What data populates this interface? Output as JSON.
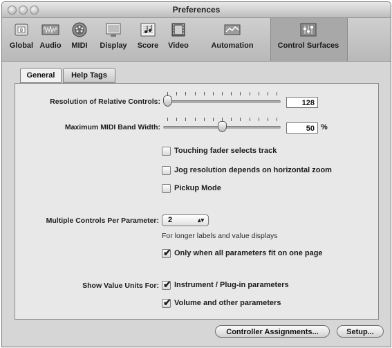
{
  "window": {
    "title": "Preferences"
  },
  "toolbar": {
    "items": [
      {
        "label": "Global",
        "icon": "global-icon"
      },
      {
        "label": "Audio",
        "icon": "audio-icon"
      },
      {
        "label": "MIDI",
        "icon": "midi-icon"
      },
      {
        "label": "Display",
        "icon": "display-icon"
      },
      {
        "label": "Score",
        "icon": "score-icon"
      },
      {
        "label": "Video",
        "icon": "video-icon"
      },
      {
        "label": "Automation",
        "icon": "automation-icon"
      },
      {
        "label": "Control Surfaces",
        "icon": "control-surfaces-icon"
      }
    ],
    "selected": "Control Surfaces"
  },
  "tabs": [
    {
      "label": "General",
      "active": true
    },
    {
      "label": "Help Tags",
      "active": false
    }
  ],
  "settings": {
    "resolution": {
      "label": "Resolution of Relative Controls:",
      "value": "128",
      "level": 0.0
    },
    "bandwidth": {
      "label": "Maximum MIDI Band Width:",
      "value": "50",
      "unit": "%",
      "level": 0.5
    },
    "options": [
      {
        "label": "Touching fader selects track",
        "checked": false
      },
      {
        "label": "Jog resolution depends on horizontal zoom",
        "checked": false
      },
      {
        "label": "Pickup Mode",
        "checked": false
      }
    ],
    "multiple": {
      "label": "Multiple Controls Per Parameter:",
      "value": "2",
      "hint": "For longer labels and value displays",
      "checkbox": {
        "label": "Only when all parameters fit on one page",
        "checked": true
      }
    },
    "units": {
      "label": "Show Value Units For:",
      "options": [
        {
          "label": "Instrument / Plug-in parameters",
          "checked": true
        },
        {
          "label": "Volume and other parameters",
          "checked": true
        }
      ]
    }
  },
  "buttons": {
    "assignments": "Controller Assignments...",
    "setup": "Setup..."
  }
}
